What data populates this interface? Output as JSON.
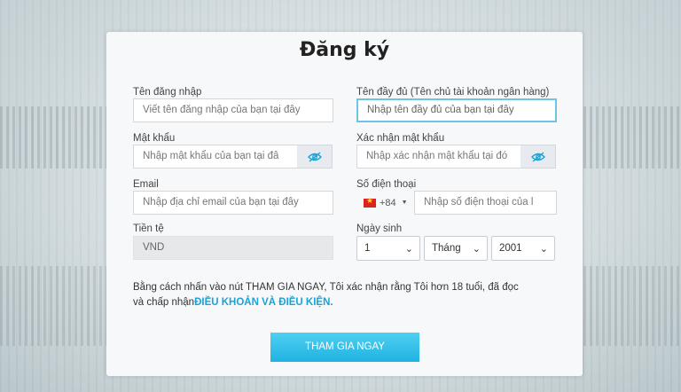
{
  "form": {
    "title": "Đăng ký",
    "username": {
      "label": "Tên đăng nhập",
      "placeholder": "Viết tên đăng nhập của bạn tại đây"
    },
    "fullname": {
      "label": "Tên đầy đủ (Tên chủ tài khoản ngân hàng)",
      "placeholder": "Nhập tên đầy đủ của bạn tại đây"
    },
    "password": {
      "label": "Mật khẩu",
      "placeholder": "Nhập mật khẩu của bạn tại đâ"
    },
    "confirm_password": {
      "label": "Xác nhận mật khẩu",
      "placeholder": "Nhập xác nhận mật khẩu tại đó"
    },
    "email": {
      "label": "Email",
      "placeholder": "Nhập địa chỉ email của bạn tại đây"
    },
    "phone": {
      "label": "Số điện thoại",
      "country_code": "+84",
      "placeholder": "Nhập số điện thoại của l"
    },
    "currency": {
      "label": "Tiền tệ",
      "value": "VND"
    },
    "birthday": {
      "label": "Ngày sinh",
      "day": "1",
      "month": "Tháng",
      "year": "2001"
    },
    "terms": {
      "text": "Bằng cách nhấn vào nút THAM GIA NGAY, Tôi xác nhận rằng Tôi hơn 18 tuổi, đã đọc và chấp nhận",
      "link": "ĐIỀU KHOẢN VÀ ĐIỀU KIỆN."
    },
    "submit_label": "THAM GIA NGAY"
  },
  "icons": {
    "password_toggle": "eye-slash-icon",
    "confirm_toggle": "eye-slash-icon",
    "flag": "vietnam-flag-icon",
    "chevron": "chevron-down-icon"
  },
  "colors": {
    "accent": "#1aa3d8",
    "button": "#2bbbe8",
    "focus_border": "#6ec4e3"
  }
}
